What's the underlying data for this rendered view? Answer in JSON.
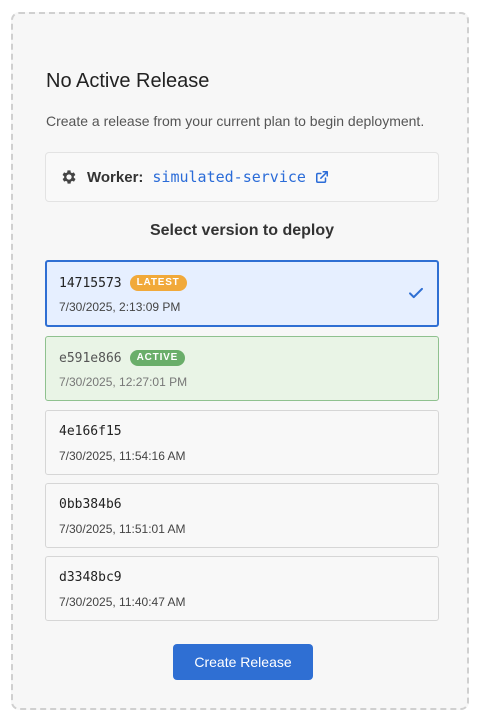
{
  "panel": {
    "title": "No Active Release",
    "description": "Create a release from your current plan to begin deployment."
  },
  "worker": {
    "icon": "gear-icon",
    "label": "Worker:",
    "name": "simulated-service",
    "link_icon": "external-link-icon"
  },
  "versions_section": {
    "title": "Select version to deploy",
    "items": [
      {
        "hash": "14715573",
        "badge": "LATEST",
        "date": "7/30/2025, 2:13:09 PM",
        "state": "selected"
      },
      {
        "hash": "e591e866",
        "badge": "ACTIVE",
        "date": "7/30/2025, 12:27:01 PM",
        "state": "active"
      },
      {
        "hash": "4e166f15",
        "badge": "",
        "date": "7/30/2025, 11:54:16 AM",
        "state": "normal"
      },
      {
        "hash": "0bb384b6",
        "badge": "",
        "date": "7/30/2025, 11:51:01 AM",
        "state": "normal"
      },
      {
        "hash": "d3348bc9",
        "badge": "",
        "date": "7/30/2025, 11:40:47 AM",
        "state": "normal"
      }
    ]
  },
  "actions": {
    "create_label": "Create Release"
  },
  "colors": {
    "accent": "#2f6fd3",
    "latest_badge": "#f1a93a",
    "active_badge": "#6aae6a",
    "selected_bg": "#e6efff",
    "active_bg": "#e9f4e6"
  }
}
